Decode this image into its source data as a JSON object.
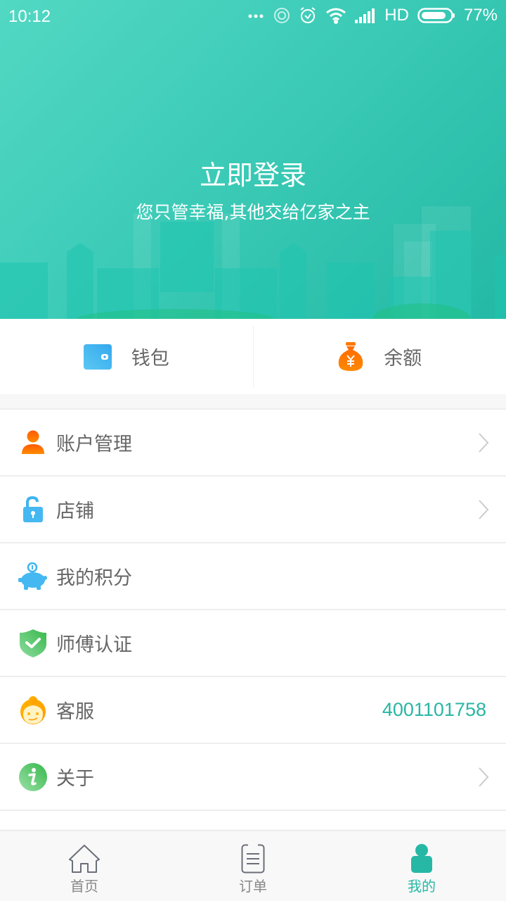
{
  "status_bar": {
    "time": "10:12",
    "network": "HD",
    "battery": "77%",
    "battery_level": 0.77,
    "icons": [
      "more-dots-icon",
      "hotspot-icon",
      "alarm-icon",
      "wifi-icon",
      "signal-icon",
      "battery-icon"
    ]
  },
  "header": {
    "title": "立即登录",
    "subtitle": "您只管幸福,其他交给亿家之主",
    "accent_color": "#3fcdb9"
  },
  "wallet_bar": {
    "items": [
      {
        "label": "钱包",
        "icon": "wallet-icon",
        "color": "#42b0ef"
      },
      {
        "label": "余额",
        "icon": "money-bag-icon",
        "color": "#ff7a00"
      }
    ]
  },
  "menu": {
    "items": [
      {
        "label": "账户管理",
        "icon": "user-icon",
        "chevron": true
      },
      {
        "label": "店铺",
        "icon": "unlock-icon",
        "chevron": true
      },
      {
        "label": "我的积分",
        "icon": "piggy-bank-icon",
        "chevron": false
      },
      {
        "label": "师傅认证",
        "icon": "shield-check-icon",
        "chevron": false
      },
      {
        "label": "客服",
        "icon": "customer-service-icon",
        "value": "4001101758",
        "chevron": false
      },
      {
        "label": "关于",
        "icon": "info-icon",
        "chevron": true
      }
    ]
  },
  "tabbar": {
    "active_color": "#26b8a5",
    "tabs": [
      {
        "label": "首页",
        "icon": "home-icon",
        "active": false
      },
      {
        "label": "订单",
        "icon": "order-list-icon",
        "active": false
      },
      {
        "label": "我的",
        "icon": "profile-icon",
        "active": true
      }
    ]
  }
}
